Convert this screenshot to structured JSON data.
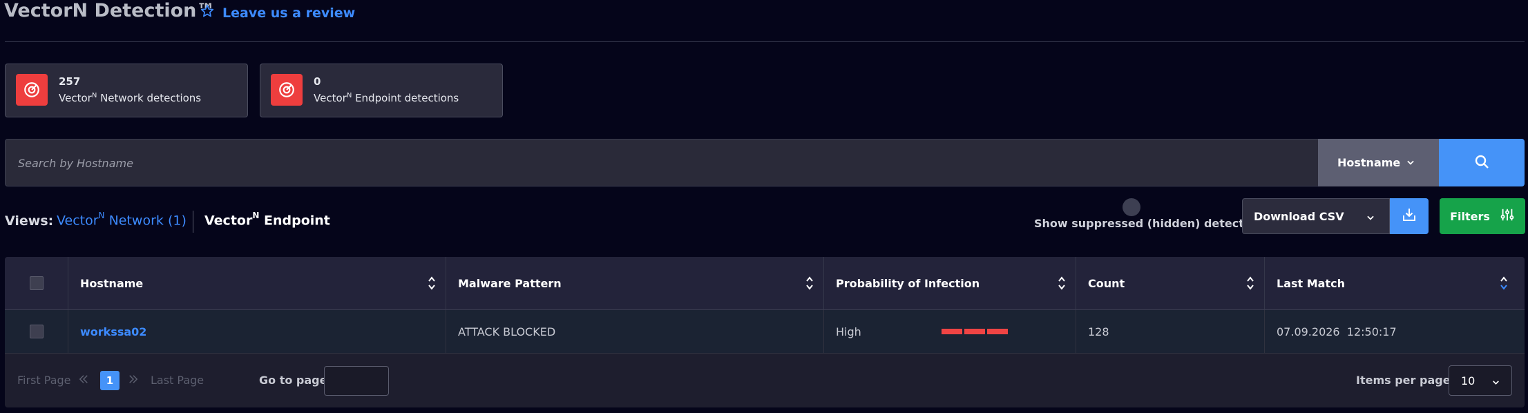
{
  "header": {
    "title": "VectorN Detection™",
    "review_link": "Leave us a review"
  },
  "cards": [
    {
      "count": "257",
      "label_prefix": "Vector",
      "label_sup": "N",
      "label_suffix": " Network detections"
    },
    {
      "count": "0",
      "label_prefix": "Vector",
      "label_sup": "N",
      "label_suffix": " Endpoint detections"
    }
  ],
  "search": {
    "placeholder": "Search by Hostname",
    "field_selector": "Hostname"
  },
  "views": {
    "label": "Views:",
    "network": {
      "prefix": "Vector",
      "sup": "N",
      "suffix": " Network (1)"
    },
    "endpoint": {
      "prefix": "Vector",
      "sup": "N",
      "suffix": " Endpoint"
    }
  },
  "toolbar": {
    "suppressed_label": "Show suppressed (hidden) detections",
    "download_label": "Download CSV",
    "filters_label": "Filters"
  },
  "table": {
    "columns": [
      "Hostname",
      "Malware Pattern",
      "Probability of Infection",
      "Count",
      "Last Match"
    ],
    "rows": [
      {
        "hostname": "workssa02",
        "malware_pattern": "ATTACK BLOCKED",
        "probability": "High",
        "probability_level_bars": 3,
        "count": "128",
        "last_match": "07.09.2026  12:50:17"
      }
    ]
  },
  "pagination": {
    "first": "First Page",
    "current": "1",
    "last": "Last Page",
    "goto_label": "Go to page:",
    "items_per_page_label": "Items per page:",
    "items_per_page_value": "10"
  },
  "colors": {
    "accent_blue": "#4593f8",
    "link_blue": "#3d8bff",
    "danger_red": "#ee3e3e",
    "success_green": "#16a34a",
    "background": "#05051a"
  }
}
